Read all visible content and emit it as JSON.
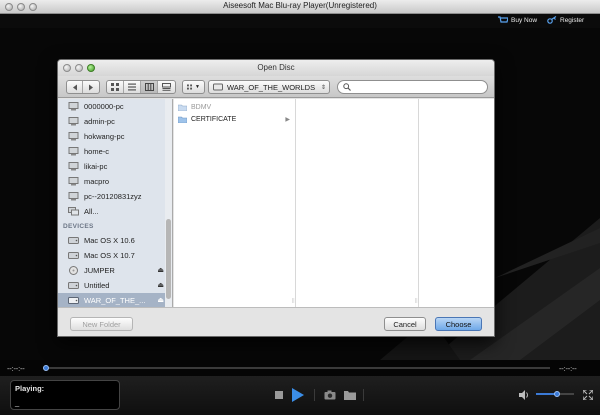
{
  "window": {
    "title": "Aiseesoft Mac Blu-ray Player(Unregistered)",
    "buy_now": "Buy Now",
    "register": "Register"
  },
  "dialog": {
    "title": "Open Disc",
    "location": "WAR_OF_THE_WORLDS",
    "search_placeholder": "",
    "new_folder": "New Folder",
    "cancel": "Cancel",
    "choose": "Choose"
  },
  "sidebar": {
    "devices_header": "DEVICES",
    "shared": [
      {
        "label": "0000000-pc",
        "icon": "computer-icon"
      },
      {
        "label": "admin-pc",
        "icon": "computer-icon"
      },
      {
        "label": "hokwang-pc",
        "icon": "computer-icon"
      },
      {
        "label": "home-c",
        "icon": "computer-icon"
      },
      {
        "label": "likai-pc",
        "icon": "computer-icon"
      },
      {
        "label": "macpro",
        "icon": "computer-icon"
      },
      {
        "label": "pc--20120831zyz",
        "icon": "computer-icon"
      },
      {
        "label": "All...",
        "icon": "network-icon"
      }
    ],
    "devices": [
      {
        "label": "Mac OS X 10.6",
        "icon": "drive-icon",
        "eject": false
      },
      {
        "label": "Mac OS X 10.7",
        "icon": "drive-icon",
        "eject": false
      },
      {
        "label": "JUMPER",
        "icon": "disc-icon",
        "eject": true
      },
      {
        "label": "Untitled",
        "icon": "drive-icon",
        "eject": true
      },
      {
        "label": "WAR_OF_THE_...",
        "icon": "drive-icon",
        "eject": true,
        "selected": true
      }
    ]
  },
  "browser": {
    "items": [
      {
        "label": "BDMV",
        "dimmed": true,
        "has_children": false
      },
      {
        "label": "CERTIFICATE",
        "dimmed": false,
        "has_children": true
      }
    ]
  },
  "player": {
    "time_left": "--:--:--",
    "time_right": "--:--:--",
    "playing_label": "Playing:",
    "playing_value": "_",
    "volume": 0.55,
    "progress": 0.0
  },
  "colors": {
    "accent": "#3b7ad6",
    "selection": "#a5b3c6",
    "sidebar_bg": "#dee4ec"
  }
}
